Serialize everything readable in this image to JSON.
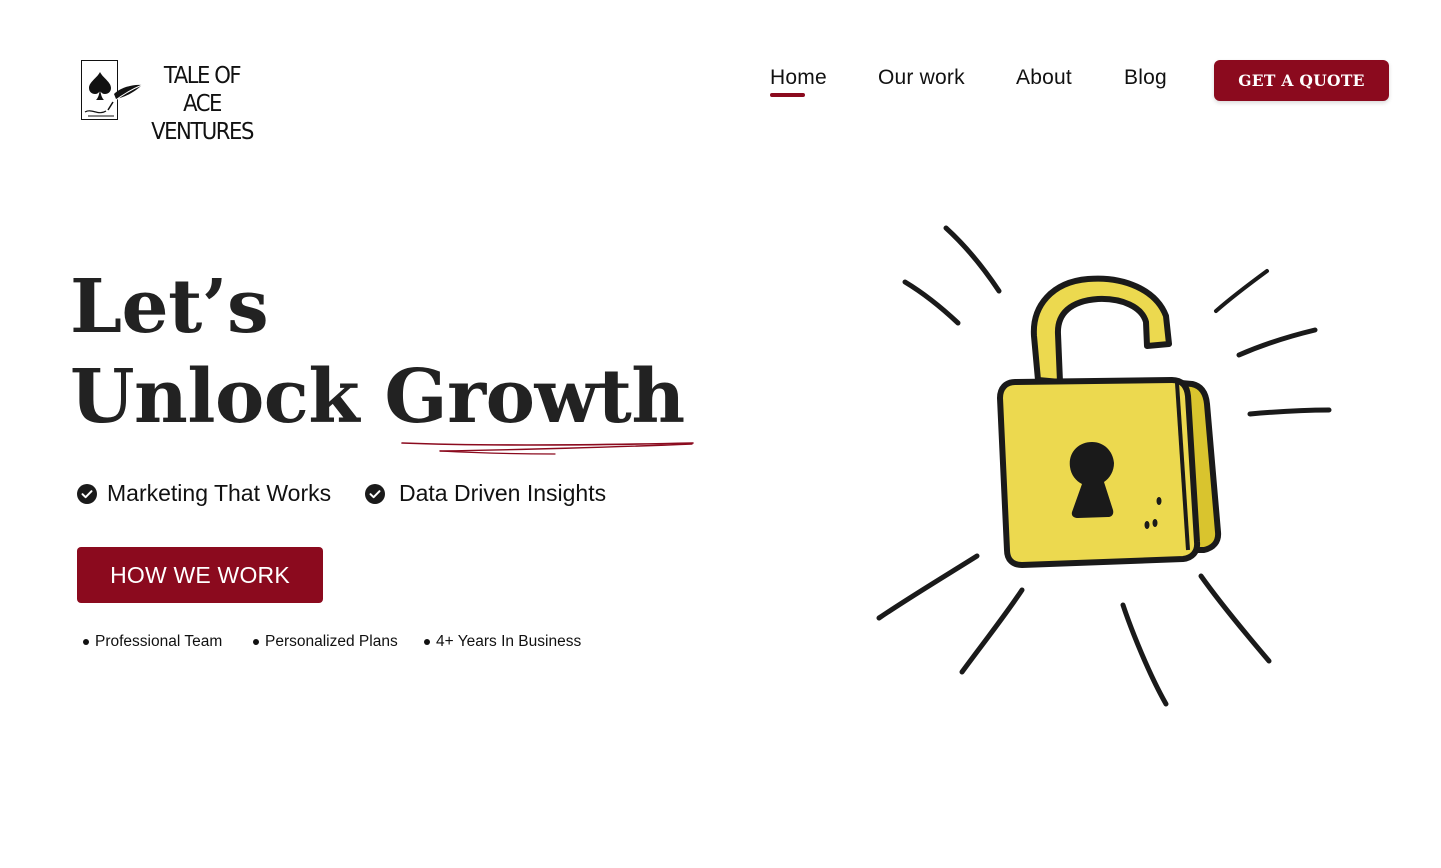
{
  "brand": {
    "line1": "TALE OF ACE",
    "line2": "VENTURES"
  },
  "nav": {
    "items": [
      {
        "label": "Home",
        "active": true
      },
      {
        "label": "Our work",
        "active": false
      },
      {
        "label": "About",
        "active": false
      },
      {
        "label": "Blog",
        "active": false
      }
    ],
    "cta_label": "GET A QUOTE"
  },
  "hero": {
    "title_line1": "Let’s",
    "title_line2": "Unlock Growth",
    "features": [
      "Marketing That Works",
      "Data Driven Insights"
    ],
    "cta_label": "HOW WE WORK",
    "highlights": [
      "Professional Team",
      "Personalized Plans",
      "4+ Years In Business"
    ],
    "illustration": "unlocked-padlock-icon"
  },
  "colors": {
    "accent": "#8b0a1e",
    "lock_yellow": "#ecd94f",
    "text": "#1a1a1a"
  }
}
